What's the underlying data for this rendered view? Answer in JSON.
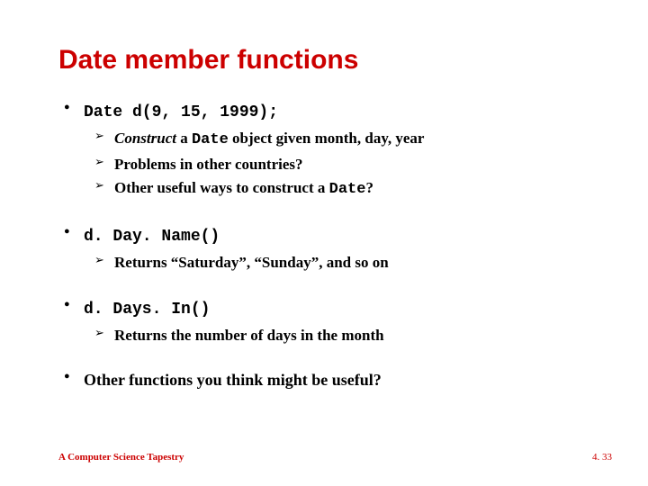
{
  "title": "Date member functions",
  "items": [
    {
      "head_code": "Date d(9, 15, 1999);",
      "sub": [
        {
          "em": "Construct",
          "plain1": " a ",
          "code": "Date",
          "plain2": " object given month, day, year"
        },
        {
          "plain": "Problems in other countries?"
        },
        {
          "plain1": "Other useful ways to construct a ",
          "code": "Date",
          "plain2": "?"
        }
      ]
    },
    {
      "head_code": "d. Day. Name()",
      "sub": [
        {
          "plain": "Returns “Saturday”, “Sunday”, and so on"
        }
      ]
    },
    {
      "head_code": "d. Days. In()",
      "sub": [
        {
          "plain": "Returns the number of days in the month"
        }
      ]
    },
    {
      "head_plain": "Other functions you think might be useful?"
    }
  ],
  "footer": "A Computer Science Tapestry",
  "pagenum": "4. 33"
}
